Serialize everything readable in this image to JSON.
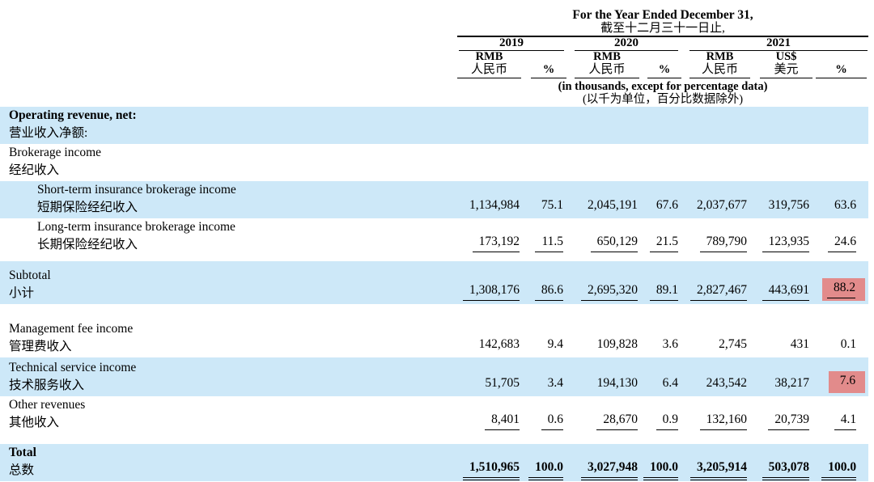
{
  "colors": {
    "row_band": "#cde8f8",
    "highlight": "#e28b8b"
  },
  "header": {
    "title_en": "For the Year Ended December 31,",
    "title_zh": "截至十二月三十一日止,",
    "years": [
      "2019",
      "2020",
      "2021"
    ],
    "col_rmb_en": "RMB",
    "col_rmb_zh": "人民币",
    "col_usd_en": "US$",
    "col_usd_zh": "美元",
    "col_pct": "%",
    "note_en": "(in thousands, except for percentage data)",
    "note_zh": "(以千为单位，百分比数据除外)"
  },
  "table": {
    "rows": [
      {
        "en": "Operating revenue, net:",
        "zh": "营业收入净额:",
        "values": null
      },
      {
        "en": "Brokerage income",
        "zh": "经纪收入",
        "values": null
      },
      {
        "en": "Short-term insurance brokerage income",
        "zh": "短期保险经纪收入",
        "values": [
          "1,134,984",
          "75.1",
          "2,045,191",
          "67.6",
          "2,037,677",
          "319,756",
          "63.6"
        ]
      },
      {
        "en": "Long-term insurance brokerage income",
        "zh": "长期保险经纪收入",
        "values": [
          "173,192",
          "11.5",
          "650,129",
          "21.5",
          "789,790",
          "123,935",
          "24.6"
        ]
      },
      {
        "en": "Subtotal",
        "zh": "小计",
        "values": [
          "1,308,176",
          "86.6",
          "2,695,320",
          "89.1",
          "2,827,467",
          "443,691",
          "88.2"
        ],
        "highlight_last": true
      },
      {
        "en": "Management fee income",
        "zh": "管理费收入",
        "values": [
          "142,683",
          "9.4",
          "109,828",
          "3.6",
          "2,745",
          "431",
          "0.1"
        ]
      },
      {
        "en": "Technical service income",
        "zh": "技术服务收入",
        "values": [
          "51,705",
          "3.4",
          "194,130",
          "6.4",
          "243,542",
          "38,217",
          "7.6"
        ],
        "highlight_last": true
      },
      {
        "en": "Other revenues",
        "zh": "其他收入",
        "values": [
          "8,401",
          "0.6",
          "28,670",
          "0.9",
          "132,160",
          "20,739",
          "4.1"
        ]
      },
      {
        "en": "Total",
        "zh": "总数",
        "values": [
          "1,510,965",
          "100.0",
          "3,027,948",
          "100.0",
          "3,205,914",
          "503,078",
          "100.0"
        ]
      }
    ]
  }
}
